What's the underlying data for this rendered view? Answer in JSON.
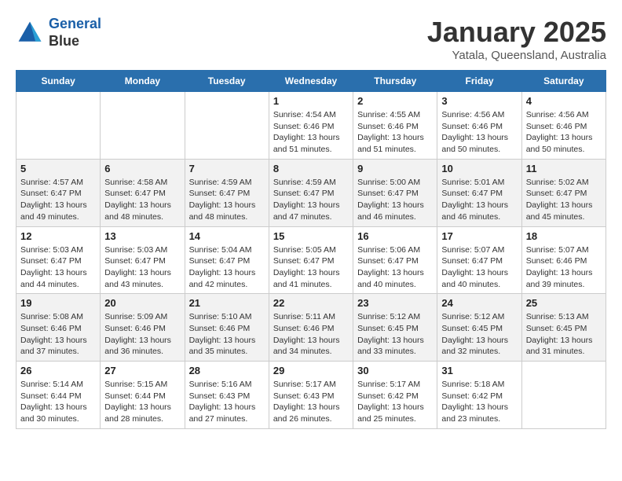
{
  "header": {
    "logo_line1": "General",
    "logo_line2": "Blue",
    "month": "January 2025",
    "location": "Yatala, Queensland, Australia"
  },
  "days_of_week": [
    "Sunday",
    "Monday",
    "Tuesday",
    "Wednesday",
    "Thursday",
    "Friday",
    "Saturday"
  ],
  "weeks": [
    [
      {
        "num": "",
        "info": ""
      },
      {
        "num": "",
        "info": ""
      },
      {
        "num": "",
        "info": ""
      },
      {
        "num": "1",
        "info": "Sunrise: 4:54 AM\nSunset: 6:46 PM\nDaylight: 13 hours\nand 51 minutes."
      },
      {
        "num": "2",
        "info": "Sunrise: 4:55 AM\nSunset: 6:46 PM\nDaylight: 13 hours\nand 51 minutes."
      },
      {
        "num": "3",
        "info": "Sunrise: 4:56 AM\nSunset: 6:46 PM\nDaylight: 13 hours\nand 50 minutes."
      },
      {
        "num": "4",
        "info": "Sunrise: 4:56 AM\nSunset: 6:46 PM\nDaylight: 13 hours\nand 50 minutes."
      }
    ],
    [
      {
        "num": "5",
        "info": "Sunrise: 4:57 AM\nSunset: 6:47 PM\nDaylight: 13 hours\nand 49 minutes."
      },
      {
        "num": "6",
        "info": "Sunrise: 4:58 AM\nSunset: 6:47 PM\nDaylight: 13 hours\nand 48 minutes."
      },
      {
        "num": "7",
        "info": "Sunrise: 4:59 AM\nSunset: 6:47 PM\nDaylight: 13 hours\nand 48 minutes."
      },
      {
        "num": "8",
        "info": "Sunrise: 4:59 AM\nSunset: 6:47 PM\nDaylight: 13 hours\nand 47 minutes."
      },
      {
        "num": "9",
        "info": "Sunrise: 5:00 AM\nSunset: 6:47 PM\nDaylight: 13 hours\nand 46 minutes."
      },
      {
        "num": "10",
        "info": "Sunrise: 5:01 AM\nSunset: 6:47 PM\nDaylight: 13 hours\nand 46 minutes."
      },
      {
        "num": "11",
        "info": "Sunrise: 5:02 AM\nSunset: 6:47 PM\nDaylight: 13 hours\nand 45 minutes."
      }
    ],
    [
      {
        "num": "12",
        "info": "Sunrise: 5:03 AM\nSunset: 6:47 PM\nDaylight: 13 hours\nand 44 minutes."
      },
      {
        "num": "13",
        "info": "Sunrise: 5:03 AM\nSunset: 6:47 PM\nDaylight: 13 hours\nand 43 minutes."
      },
      {
        "num": "14",
        "info": "Sunrise: 5:04 AM\nSunset: 6:47 PM\nDaylight: 13 hours\nand 42 minutes."
      },
      {
        "num": "15",
        "info": "Sunrise: 5:05 AM\nSunset: 6:47 PM\nDaylight: 13 hours\nand 41 minutes."
      },
      {
        "num": "16",
        "info": "Sunrise: 5:06 AM\nSunset: 6:47 PM\nDaylight: 13 hours\nand 40 minutes."
      },
      {
        "num": "17",
        "info": "Sunrise: 5:07 AM\nSunset: 6:47 PM\nDaylight: 13 hours\nand 40 minutes."
      },
      {
        "num": "18",
        "info": "Sunrise: 5:07 AM\nSunset: 6:46 PM\nDaylight: 13 hours\nand 39 minutes."
      }
    ],
    [
      {
        "num": "19",
        "info": "Sunrise: 5:08 AM\nSunset: 6:46 PM\nDaylight: 13 hours\nand 37 minutes."
      },
      {
        "num": "20",
        "info": "Sunrise: 5:09 AM\nSunset: 6:46 PM\nDaylight: 13 hours\nand 36 minutes."
      },
      {
        "num": "21",
        "info": "Sunrise: 5:10 AM\nSunset: 6:46 PM\nDaylight: 13 hours\nand 35 minutes."
      },
      {
        "num": "22",
        "info": "Sunrise: 5:11 AM\nSunset: 6:46 PM\nDaylight: 13 hours\nand 34 minutes."
      },
      {
        "num": "23",
        "info": "Sunrise: 5:12 AM\nSunset: 6:45 PM\nDaylight: 13 hours\nand 33 minutes."
      },
      {
        "num": "24",
        "info": "Sunrise: 5:12 AM\nSunset: 6:45 PM\nDaylight: 13 hours\nand 32 minutes."
      },
      {
        "num": "25",
        "info": "Sunrise: 5:13 AM\nSunset: 6:45 PM\nDaylight: 13 hours\nand 31 minutes."
      }
    ],
    [
      {
        "num": "26",
        "info": "Sunrise: 5:14 AM\nSunset: 6:44 PM\nDaylight: 13 hours\nand 30 minutes."
      },
      {
        "num": "27",
        "info": "Sunrise: 5:15 AM\nSunset: 6:44 PM\nDaylight: 13 hours\nand 28 minutes."
      },
      {
        "num": "28",
        "info": "Sunrise: 5:16 AM\nSunset: 6:43 PM\nDaylight: 13 hours\nand 27 minutes."
      },
      {
        "num": "29",
        "info": "Sunrise: 5:17 AM\nSunset: 6:43 PM\nDaylight: 13 hours\nand 26 minutes."
      },
      {
        "num": "30",
        "info": "Sunrise: 5:17 AM\nSunset: 6:42 PM\nDaylight: 13 hours\nand 25 minutes."
      },
      {
        "num": "31",
        "info": "Sunrise: 5:18 AM\nSunset: 6:42 PM\nDaylight: 13 hours\nand 23 minutes."
      },
      {
        "num": "",
        "info": ""
      }
    ]
  ]
}
